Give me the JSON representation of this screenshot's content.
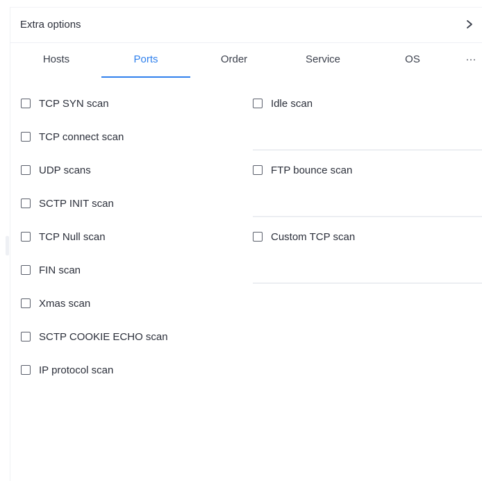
{
  "header": {
    "title": "Extra options",
    "expand_icon": "chevron-right-icon"
  },
  "tabs": [
    {
      "label": "Hosts",
      "active": false
    },
    {
      "label": "Ports",
      "active": true
    },
    {
      "label": "Order",
      "active": false
    },
    {
      "label": "Service",
      "active": false
    },
    {
      "label": "OS",
      "active": false
    },
    {
      "label": "···",
      "active": false
    }
  ],
  "accent_color": "#2f80ed",
  "left_options": [
    {
      "label": "TCP SYN scan",
      "checked": false
    },
    {
      "label": "TCP connect scan",
      "checked": false
    },
    {
      "label": "UDP scans",
      "checked": false
    },
    {
      "label": "SCTP INIT scan",
      "checked": false
    },
    {
      "label": "TCP Null scan",
      "checked": false
    },
    {
      "label": "FIN scan",
      "checked": false
    },
    {
      "label": "Xmas scan",
      "checked": false
    },
    {
      "label": "SCTP COOKIE ECHO scan",
      "checked": false
    },
    {
      "label": "IP protocol scan",
      "checked": false
    }
  ],
  "right_options": [
    {
      "label": "Idle scan",
      "checked": false
    },
    {
      "label": "FTP bounce scan",
      "checked": false
    },
    {
      "label": "Custom TCP scan",
      "checked": false
    }
  ]
}
